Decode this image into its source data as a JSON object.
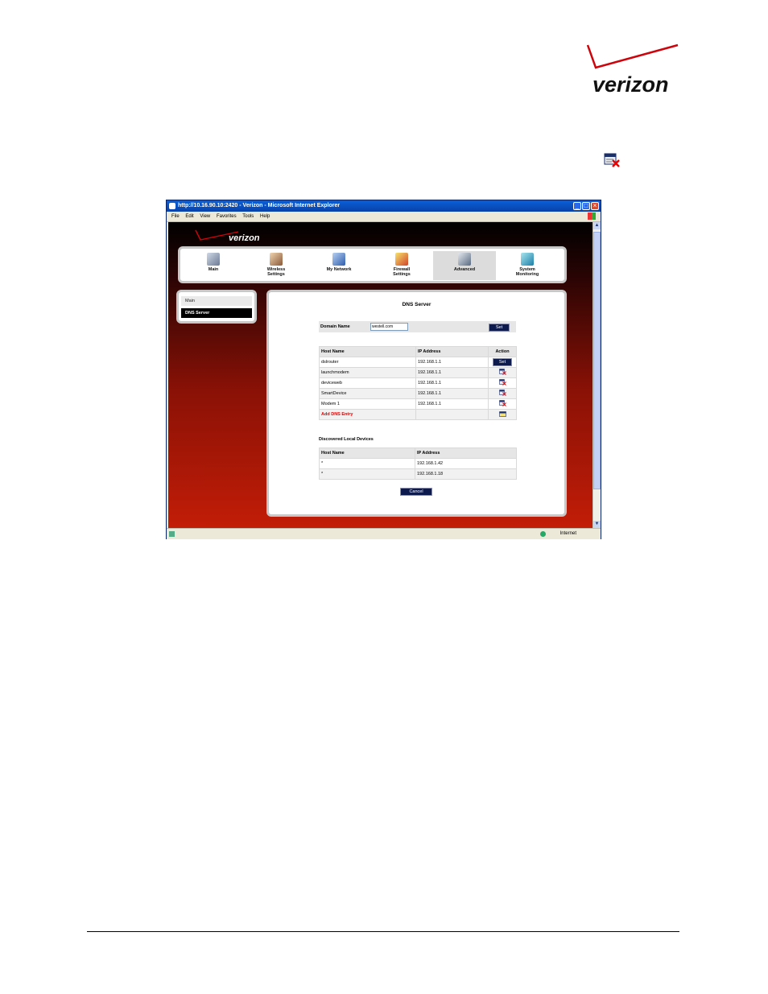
{
  "document": {
    "logo_text": "verizon",
    "delete_icon": "delete-entry-icon"
  },
  "browser": {
    "title": "http://10.16.90.10:2420 - Verizon - Microsoft Internet Explorer",
    "menu": [
      "File",
      "Edit",
      "View",
      "Favorites",
      "Tools",
      "Help"
    ],
    "status_zone": "Internet"
  },
  "app": {
    "logo_text": "verizon",
    "nav": [
      {
        "label1": "Main",
        "label2": "",
        "icon": "main-icon"
      },
      {
        "label1": "Wireless",
        "label2": "Settings",
        "icon": "wireless-icon"
      },
      {
        "label1": "My Network",
        "label2": "",
        "icon": "network-icon"
      },
      {
        "label1": "Firewall",
        "label2": "Settings",
        "icon": "firewall-icon"
      },
      {
        "label1": "Advanced",
        "label2": "",
        "icon": "advanced-icon"
      },
      {
        "label1": "System",
        "label2": "Monitoring",
        "icon": "monitoring-icon"
      }
    ],
    "active_nav": "Advanced",
    "side": {
      "main": "Main",
      "active": "DNS Server"
    },
    "panel": {
      "title": "DNS Server",
      "domain_label": "Domain Name",
      "domain_value": "westell.com",
      "set_label": "Set",
      "hosts_headers": [
        "Host Name",
        "IP Address",
        "Action"
      ],
      "hosts": [
        {
          "name": "dslrouter",
          "ip": "192.168.1.1",
          "action": "Set"
        },
        {
          "name": "launchmodem",
          "ip": "192.168.1.1",
          "action": "delete"
        },
        {
          "name": "deviceweb",
          "ip": "192.168.1.1",
          "action": "delete"
        },
        {
          "name": "SmartDevice",
          "ip": "192.168.1.1",
          "action": "delete"
        },
        {
          "name": "Modem 1",
          "ip": "192.168.1.1",
          "action": "delete"
        }
      ],
      "add_entry": "Add DNS Entry",
      "discovered_title": "Discovered Local Devices",
      "discovered_headers": [
        "Host Name",
        "IP Address"
      ],
      "discovered": [
        {
          "name": "*",
          "ip": "192.168.1.42"
        },
        {
          "name": "*",
          "ip": "192.168.1.18"
        }
      ],
      "cancel_label": "Cancel"
    }
  },
  "colors": {
    "brand_red": "#cd040b",
    "button_navy": "#0c1a4e",
    "add_link": "#e00000"
  }
}
